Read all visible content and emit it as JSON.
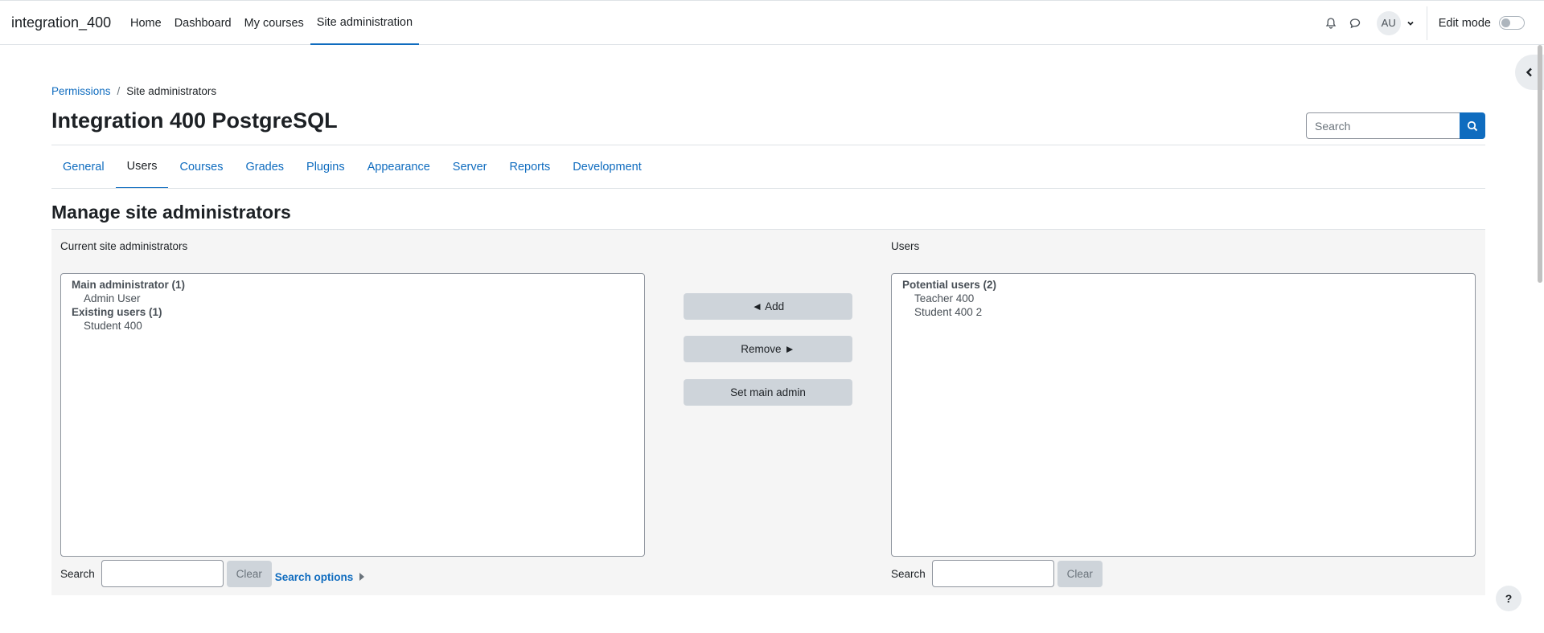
{
  "navbar": {
    "brand": "integration_400",
    "items": [
      {
        "label": "Home"
      },
      {
        "label": "Dashboard"
      },
      {
        "label": "My courses"
      },
      {
        "label": "Site administration"
      }
    ],
    "user_initials": "AU",
    "edit_mode_label": "Edit mode"
  },
  "breadcrumb": {
    "parent": "Permissions",
    "current": "Site administrators"
  },
  "page": {
    "title": "Integration 400 PostgreSQL",
    "search_placeholder": "Search"
  },
  "tabs": [
    {
      "label": "General"
    },
    {
      "label": "Users"
    },
    {
      "label": "Courses"
    },
    {
      "label": "Grades"
    },
    {
      "label": "Plugins"
    },
    {
      "label": "Appearance"
    },
    {
      "label": "Server"
    },
    {
      "label": "Reports"
    },
    {
      "label": "Development"
    }
  ],
  "section_title": "Manage site administrators",
  "current": {
    "label": "Current site administrators",
    "groups": [
      {
        "label": "Main administrator (1)",
        "options": [
          "Admin User"
        ]
      },
      {
        "label": "Existing users (1)",
        "options": [
          "Student 400"
        ]
      }
    ],
    "search_label": "Search",
    "clear_label": "Clear",
    "search_options_label": "Search options"
  },
  "actions": {
    "add_label": "◄ Add",
    "remove_label": "Remove ►",
    "set_main_label": "Set main admin"
  },
  "potential": {
    "label": "Users",
    "groups": [
      {
        "label": "Potential users (2)",
        "options": [
          "Teacher 400",
          "Student 400 2"
        ]
      }
    ],
    "search_label": "Search",
    "clear_label": "Clear"
  },
  "help_label": "?"
}
